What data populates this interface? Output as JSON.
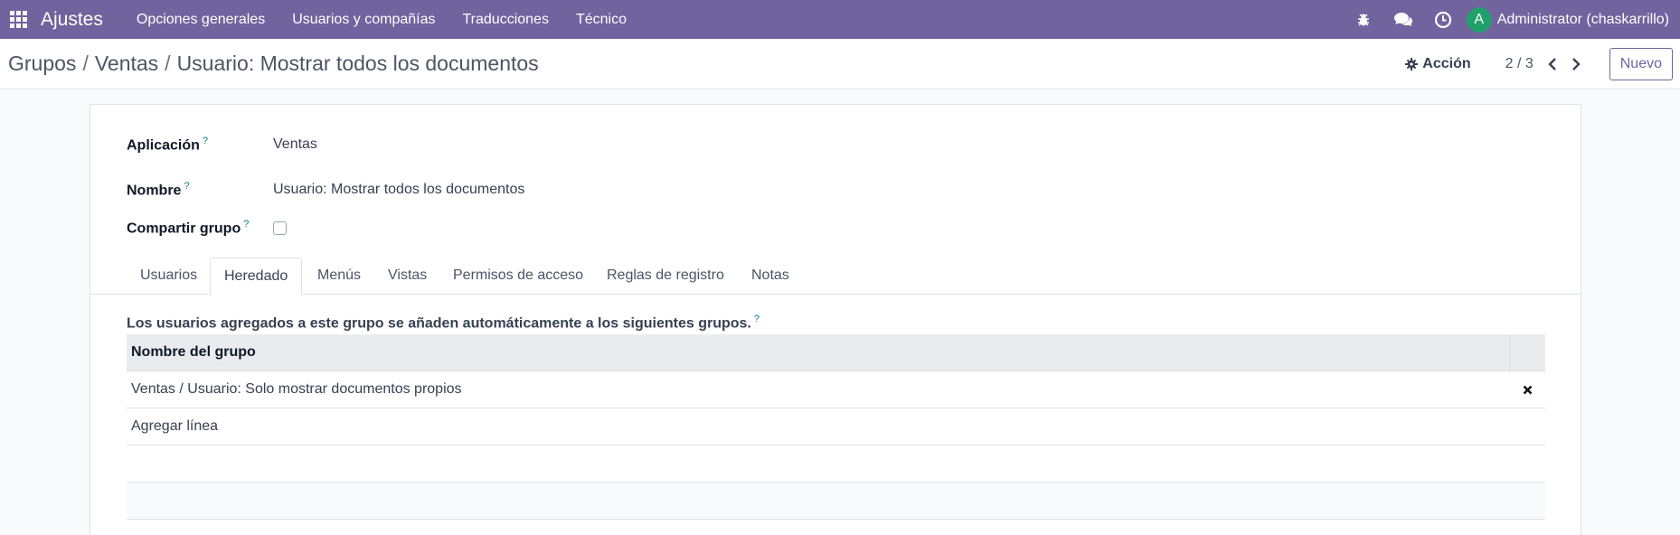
{
  "navbar": {
    "app_title": "Ajustes",
    "menu": [
      "Opciones generales",
      "Usuarios y compañías",
      "Traducciones",
      "Técnico"
    ],
    "avatar_letter": "A",
    "user": "Administrator (chaskarrillo)",
    "icons": [
      "apps-grid-icon",
      "bug-icon",
      "chat-icon",
      "clock-icon"
    ]
  },
  "control_panel": {
    "breadcrumb": [
      "Grupos",
      "Ventas",
      "Usuario: Mostrar todos los documentos"
    ],
    "breadcrumb_sep": "/",
    "action_label": "Acción",
    "pager": "2 / 3",
    "new_label": "Nuevo"
  },
  "form": {
    "fields": {
      "application": {
        "label": "Aplicación",
        "help": "?",
        "value": "Ventas"
      },
      "name": {
        "label": "Nombre",
        "help": "?",
        "value": "Usuario: Mostrar todos los documentos"
      },
      "share": {
        "label": "Compartir grupo",
        "help": "?",
        "checked": false
      }
    },
    "tabs": [
      "Usuarios",
      "Heredado",
      "Menús",
      "Vistas",
      "Permisos de acceso",
      "Reglas de registro",
      "Notas"
    ],
    "active_tab": "Heredado",
    "inherited": {
      "help_text": "Los usuarios agregados a este grupo se añaden automáticamente a los siguientes grupos.",
      "help": "?",
      "column_header": "Nombre del grupo",
      "rows": [
        "Ventas / Usuario: Solo mostrar documentos propios"
      ],
      "add_line": "Agregar línea"
    }
  },
  "colors": {
    "navbar": "#71639e",
    "avatar": "#21a06c",
    "help_marker": "#017e84"
  }
}
